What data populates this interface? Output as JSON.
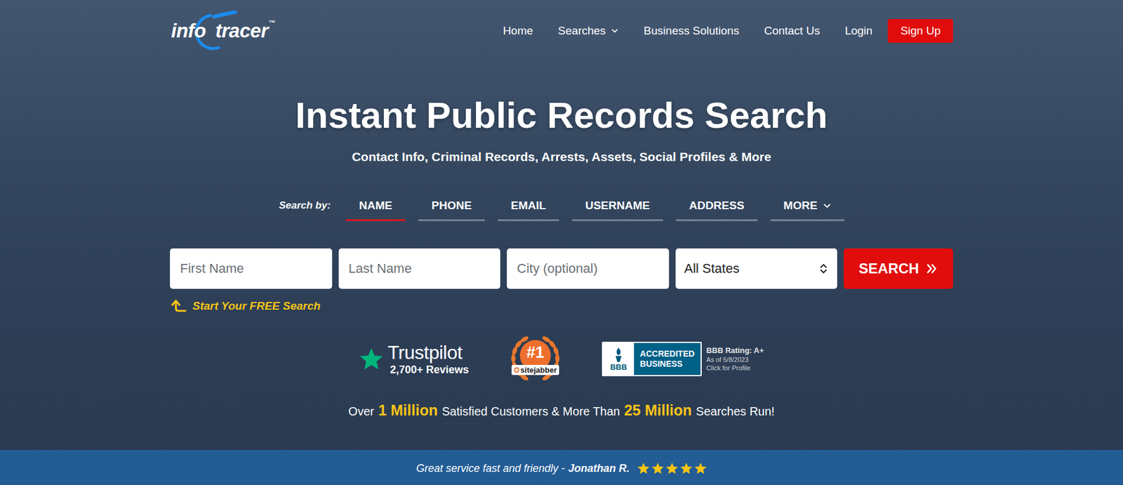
{
  "logo": {
    "parts": [
      "info",
      "tracer"
    ],
    "mark": "™"
  },
  "nav": {
    "items": [
      {
        "label": "Home",
        "dropdown": false
      },
      {
        "label": "Searches",
        "dropdown": true
      },
      {
        "label": "Business Solutions",
        "dropdown": false
      },
      {
        "label": "Contact Us",
        "dropdown": false
      },
      {
        "label": "Login",
        "dropdown": false
      }
    ],
    "signup": "Sign Up"
  },
  "hero": {
    "title": "Instant Public Records Search",
    "subtitle": "Contact Info, Criminal Records, Arrests, Assets, Social Profiles & More"
  },
  "search_by": {
    "label": "Search by:",
    "tabs": [
      {
        "label": "NAME",
        "selected": true,
        "dropdown": false
      },
      {
        "label": "PHONE",
        "selected": false,
        "dropdown": false
      },
      {
        "label": "EMAIL",
        "selected": false,
        "dropdown": false
      },
      {
        "label": "USERNAME",
        "selected": false,
        "dropdown": false
      },
      {
        "label": "ADDRESS",
        "selected": false,
        "dropdown": false
      },
      {
        "label": "MORE",
        "selected": false,
        "dropdown": true
      }
    ]
  },
  "form": {
    "fields": [
      {
        "kind": "input",
        "placeholder": "First Name",
        "value": ""
      },
      {
        "kind": "input",
        "placeholder": "Last Name",
        "value": ""
      },
      {
        "kind": "input",
        "placeholder": "City (optional)",
        "value": ""
      },
      {
        "kind": "select",
        "placeholder": "",
        "value": "All States"
      }
    ],
    "button": "SEARCH",
    "hint": "Start Your FREE Search"
  },
  "badges": {
    "trustpilot": {
      "name": "Trustpilot",
      "reviews": "2,700+ Reviews"
    },
    "sitejabber": {
      "rank": "#1",
      "name": "sitejabber"
    },
    "bbb": {
      "seal": "BBB",
      "lines": [
        "ACCREDITED",
        "BUSINESS"
      ],
      "rating": "BBB Rating: A+",
      "date": "As of 5/8/2023",
      "link": "Click for Profile"
    }
  },
  "stats": [
    {
      "text": "Over",
      "highlight": false
    },
    {
      "text": "1 Million",
      "highlight": true
    },
    {
      "text": "Satisfied Customers & More Than",
      "highlight": false
    },
    {
      "text": "25 Million",
      "highlight": true
    },
    {
      "text": "Searches Run!",
      "highlight": false
    }
  ],
  "testimonial": {
    "quote": "Great service fast and friendly -",
    "author": "Jonathan R.",
    "stars": 5
  }
}
